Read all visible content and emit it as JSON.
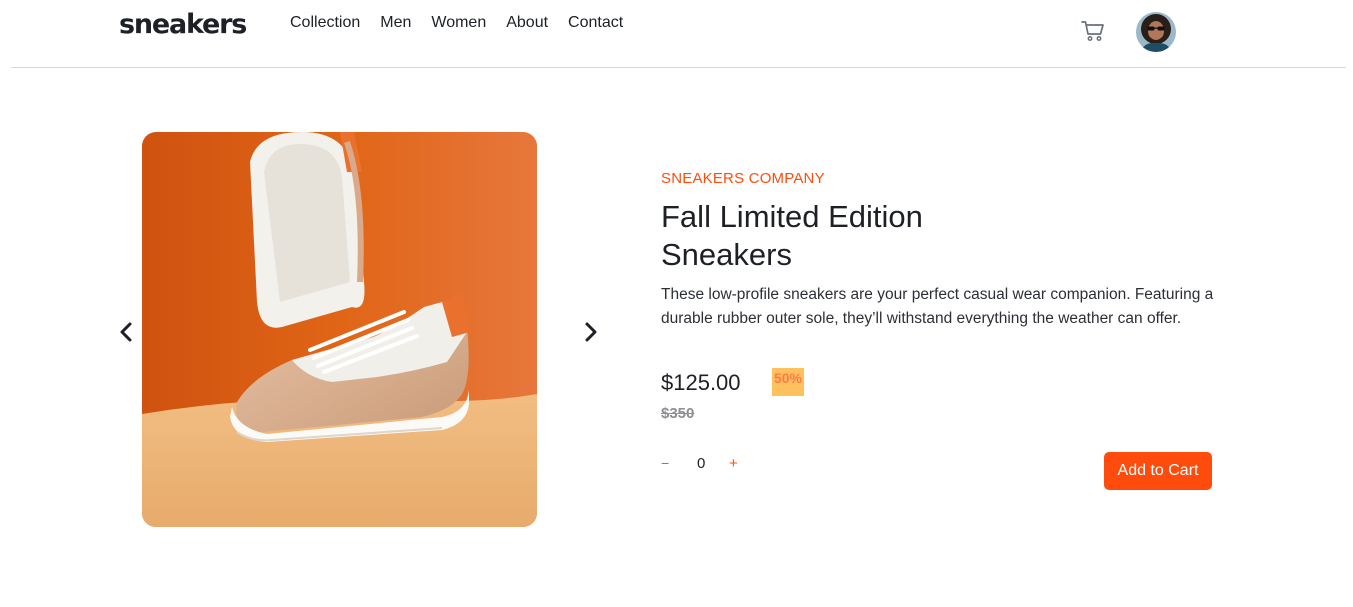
{
  "header": {
    "logo": "sneakers",
    "nav": [
      "Collection",
      "Men",
      "Women",
      "About",
      "Contact"
    ]
  },
  "product": {
    "company": "SNEAKERS COMPANY",
    "title_line1": "Fall Limited Edition",
    "title_line2": "Sneakers",
    "description": "These low-profile sneakers are your perfect casual wear companion. Featuring a durable rubber outer sole, they’ll withstand everything the weather can offer.",
    "price": "$125.00",
    "discount": "50%",
    "old_price": "$350",
    "quantity": "0",
    "minus_label": "−",
    "plus_label": "+",
    "add_to_cart_label": "Add to Cart"
  },
  "colors": {
    "accent": "#ff4c0c",
    "discount_bg": "#ffc05e",
    "text": "#1d2026"
  },
  "icons": {
    "cart": "cart-icon",
    "prev": "chevron-left-icon",
    "next": "chevron-right-icon"
  }
}
